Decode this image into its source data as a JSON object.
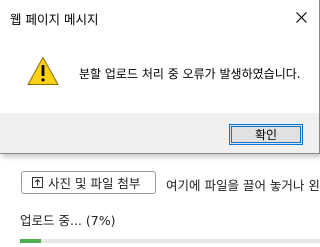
{
  "dialog": {
    "title": "웹 페이지 메시지",
    "message": "분할 업로드 처리 중 오류가 발생하였습니다.",
    "ok_label": "확인",
    "close_icon": "close-icon",
    "warning_icon": "warning-icon"
  },
  "page": {
    "attach_button_label": "사진 및 파일 첨부",
    "attach_icon": "upload-icon",
    "drop_hint": "여기에 파일을 끌어 놓거나 왼",
    "upload_status": "업로드 중... (7%)",
    "upload_progress_percent": 7
  },
  "colors": {
    "accent": "#0078d7",
    "progress": "#4caf50",
    "warning_fill": "#fcd116"
  }
}
